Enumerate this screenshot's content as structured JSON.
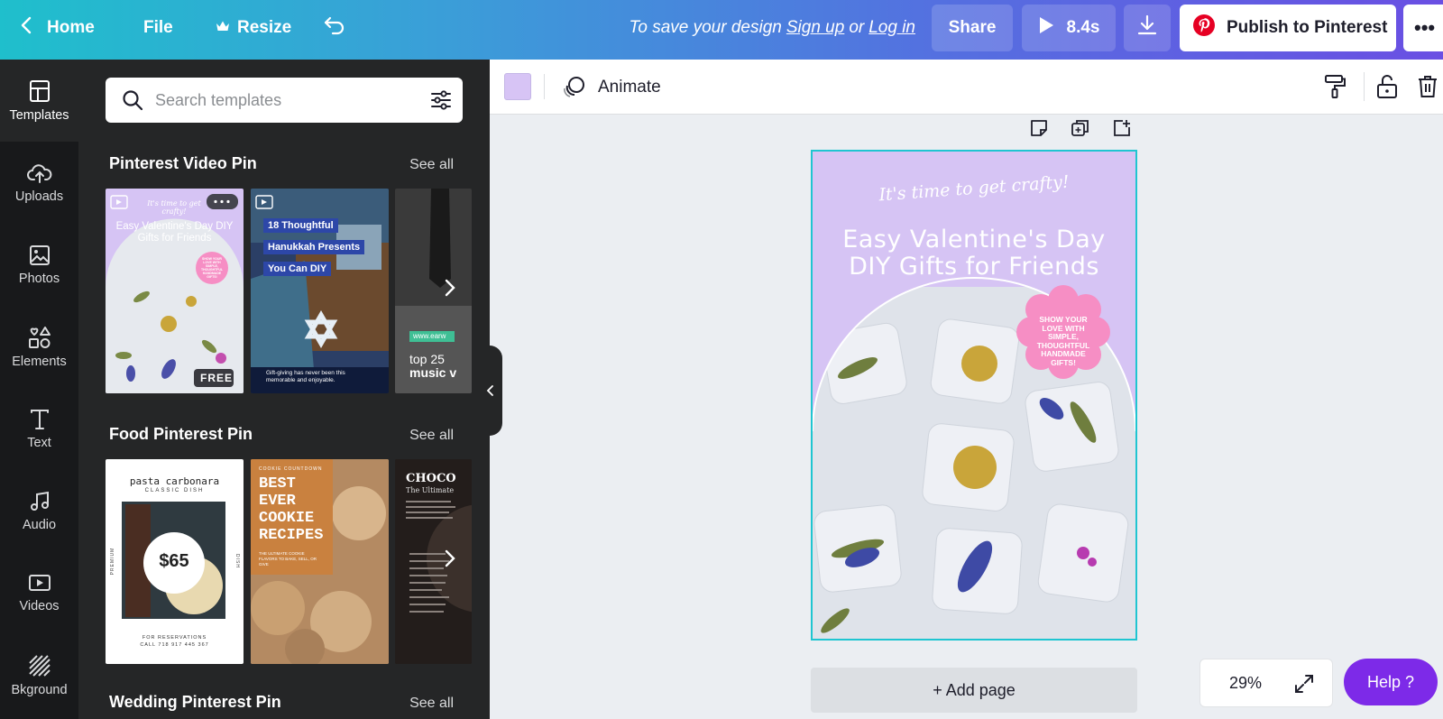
{
  "topbar": {
    "home_label": "Home",
    "file_label": "File",
    "resize_label": "Resize",
    "save_prefix": "To save your design",
    "sign_up_label": "Sign up",
    "or_label": "or",
    "log_in_label": "Log in",
    "share_label": "Share",
    "play_duration": "8.4s",
    "publish_label": "Publish to Pinterest",
    "more_label": "•••"
  },
  "rail": {
    "items": [
      {
        "label": "Templates",
        "icon": "layout-icon"
      },
      {
        "label": "Uploads",
        "icon": "upload-cloud-icon"
      },
      {
        "label": "Photos",
        "icon": "image-icon"
      },
      {
        "label": "Elements",
        "icon": "shapes-icon"
      },
      {
        "label": "Text",
        "icon": "text-icon"
      },
      {
        "label": "Audio",
        "icon": "music-icon"
      },
      {
        "label": "Videos",
        "icon": "video-icon"
      },
      {
        "label": "Bkground",
        "icon": "background-pattern-icon"
      }
    ]
  },
  "panel": {
    "search_placeholder": "Search templates",
    "sections": [
      {
        "title": "Pinterest Video Pin",
        "see_all": "See all"
      },
      {
        "title": "Food Pinterest Pin",
        "see_all": "See all"
      },
      {
        "title": "Wedding Pinterest Pin",
        "see_all": "See all"
      }
    ],
    "video_pins": {
      "t1": {
        "script": "It's time to get crafty!",
        "heading": "Easy Valentine's Day DIY Gifts for Friends",
        "badge": "FREE",
        "flower_text": "SHOW YOUR LOVE WITH SIMPLE, THOUGHTFUL HANDMADE GIFTS!"
      },
      "t2": {
        "line1": "18 Thoughtful",
        "line2": "Hanukkah Presents",
        "line3": "You Can DIY",
        "footer": "Gift-giving has never been this memorable and enjoyable."
      },
      "t3": {
        "url": "www.earw",
        "line1": "top 25",
        "line2": "music v"
      }
    },
    "food_pins": {
      "t1": {
        "title": "pasta carbonara",
        "subtitle": "CLASSIC DISH",
        "price": "$65",
        "side_left": "PREMIUM",
        "side_right": "DISH",
        "footer1": "FOR RESERVATIONS",
        "footer2": "CALL 718 917 445 367"
      },
      "t2": {
        "kicker": "COOKIE COUNTDOWN",
        "heading": "BEST EVER COOKIE RECIPES",
        "sub": "THE ULTIMATE COOKIE FLAVORS TO BAKE, SELL, OR GIVE"
      },
      "t3": {
        "title": "CHOCO",
        "subtitle": "The Ultimate"
      }
    }
  },
  "editor": {
    "swatch_color": "#d7c4f5",
    "animate_label": "Animate",
    "design": {
      "script": "It's time to get crafty!",
      "heading_line1": "Easy Valentine's Day",
      "heading_line2": "DIY Gifts for Friends",
      "flower_text": "SHOW YOUR LOVE WITH SIMPLE, THOUGHTFUL HANDMADE GIFTS!"
    },
    "add_page_label": "+ Add page",
    "zoom_label": "29%",
    "help_label": "Help ?"
  },
  "colors": {
    "accent_purple": "#7d2ae8",
    "selection": "#1fc5d1",
    "design_bg": "#d6c4f4",
    "flower_pink": "#f68ec4"
  }
}
